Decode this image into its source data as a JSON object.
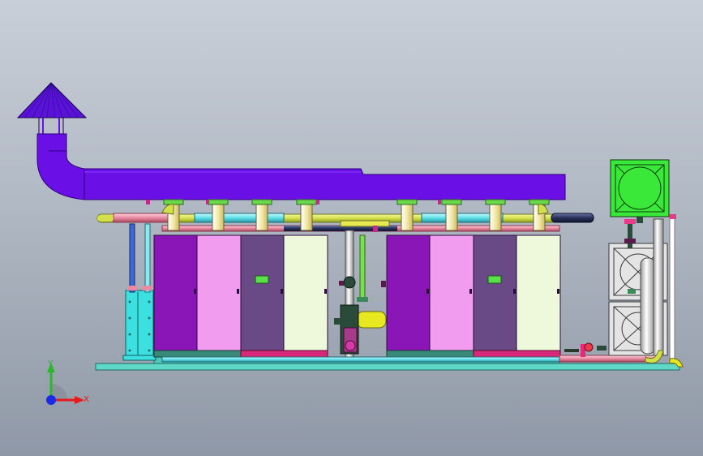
{
  "viewport": {
    "background_top": "#c9cfd8",
    "background_bottom": "#8f98a6"
  },
  "colors": {
    "duct": "#6a10e6",
    "duct_edge": "#2c007a",
    "cap": "#5a12d8",
    "boiler_purple": "#8a16b8",
    "boiler_pink": "#f29cf0",
    "boiler_dark": "#6a4a86",
    "boiler_cream": "#eef9dc",
    "pipe_yellow": "#d4e04a",
    "pipe_cyan": "#5fe0e8",
    "pipe_pink": "#e88aa0",
    "pipe_navy": "#28305a",
    "pipe_green": "#7ae04a",
    "base": "#5fd8c8",
    "tank_green": "#39e839",
    "heat_exchanger": "#3ce0e0",
    "panel_grey": "#e4e4e4"
  },
  "triad": {
    "x_label": "X",
    "y_label": "Y",
    "x_color": "#e81a1a",
    "y_color": "#2ab82a",
    "z_color": "#1a2ae8"
  }
}
